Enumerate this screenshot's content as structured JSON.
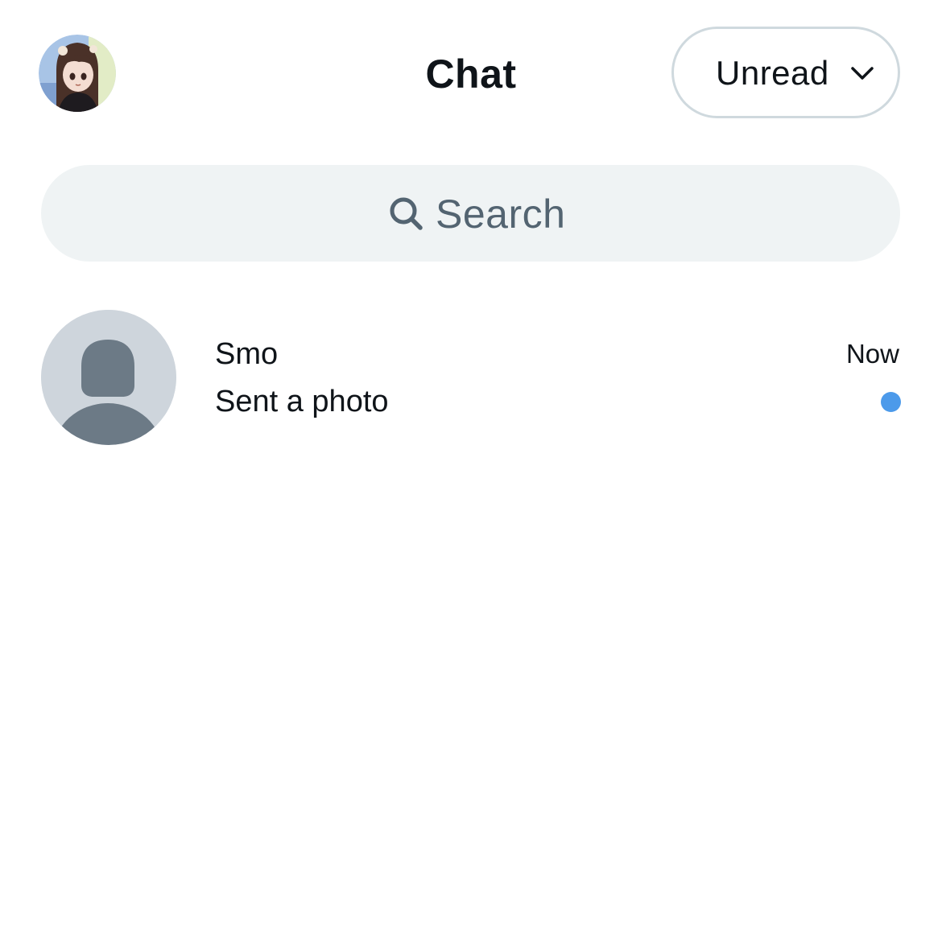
{
  "header": {
    "title": "Chat",
    "profile_icon": "profile-avatar-icon",
    "filter": {
      "label": "Unread",
      "icon": "chevron-down-icon"
    }
  },
  "search": {
    "placeholder": "Search",
    "icon": "search-icon"
  },
  "conversations": [
    {
      "name": "Smo",
      "preview": "Sent a photo",
      "time": "Now",
      "unread": true,
      "avatar_icon": "default-person-icon"
    }
  ],
  "colors": {
    "text_primary": "#0f1419",
    "text_secondary": "#536471",
    "search_bg": "#eff3f4",
    "border": "#cfd9de",
    "unread_dot": "#4c9aea",
    "default_avatar_bg": "#ced5dc",
    "default_avatar_fg": "#6c7a86"
  }
}
